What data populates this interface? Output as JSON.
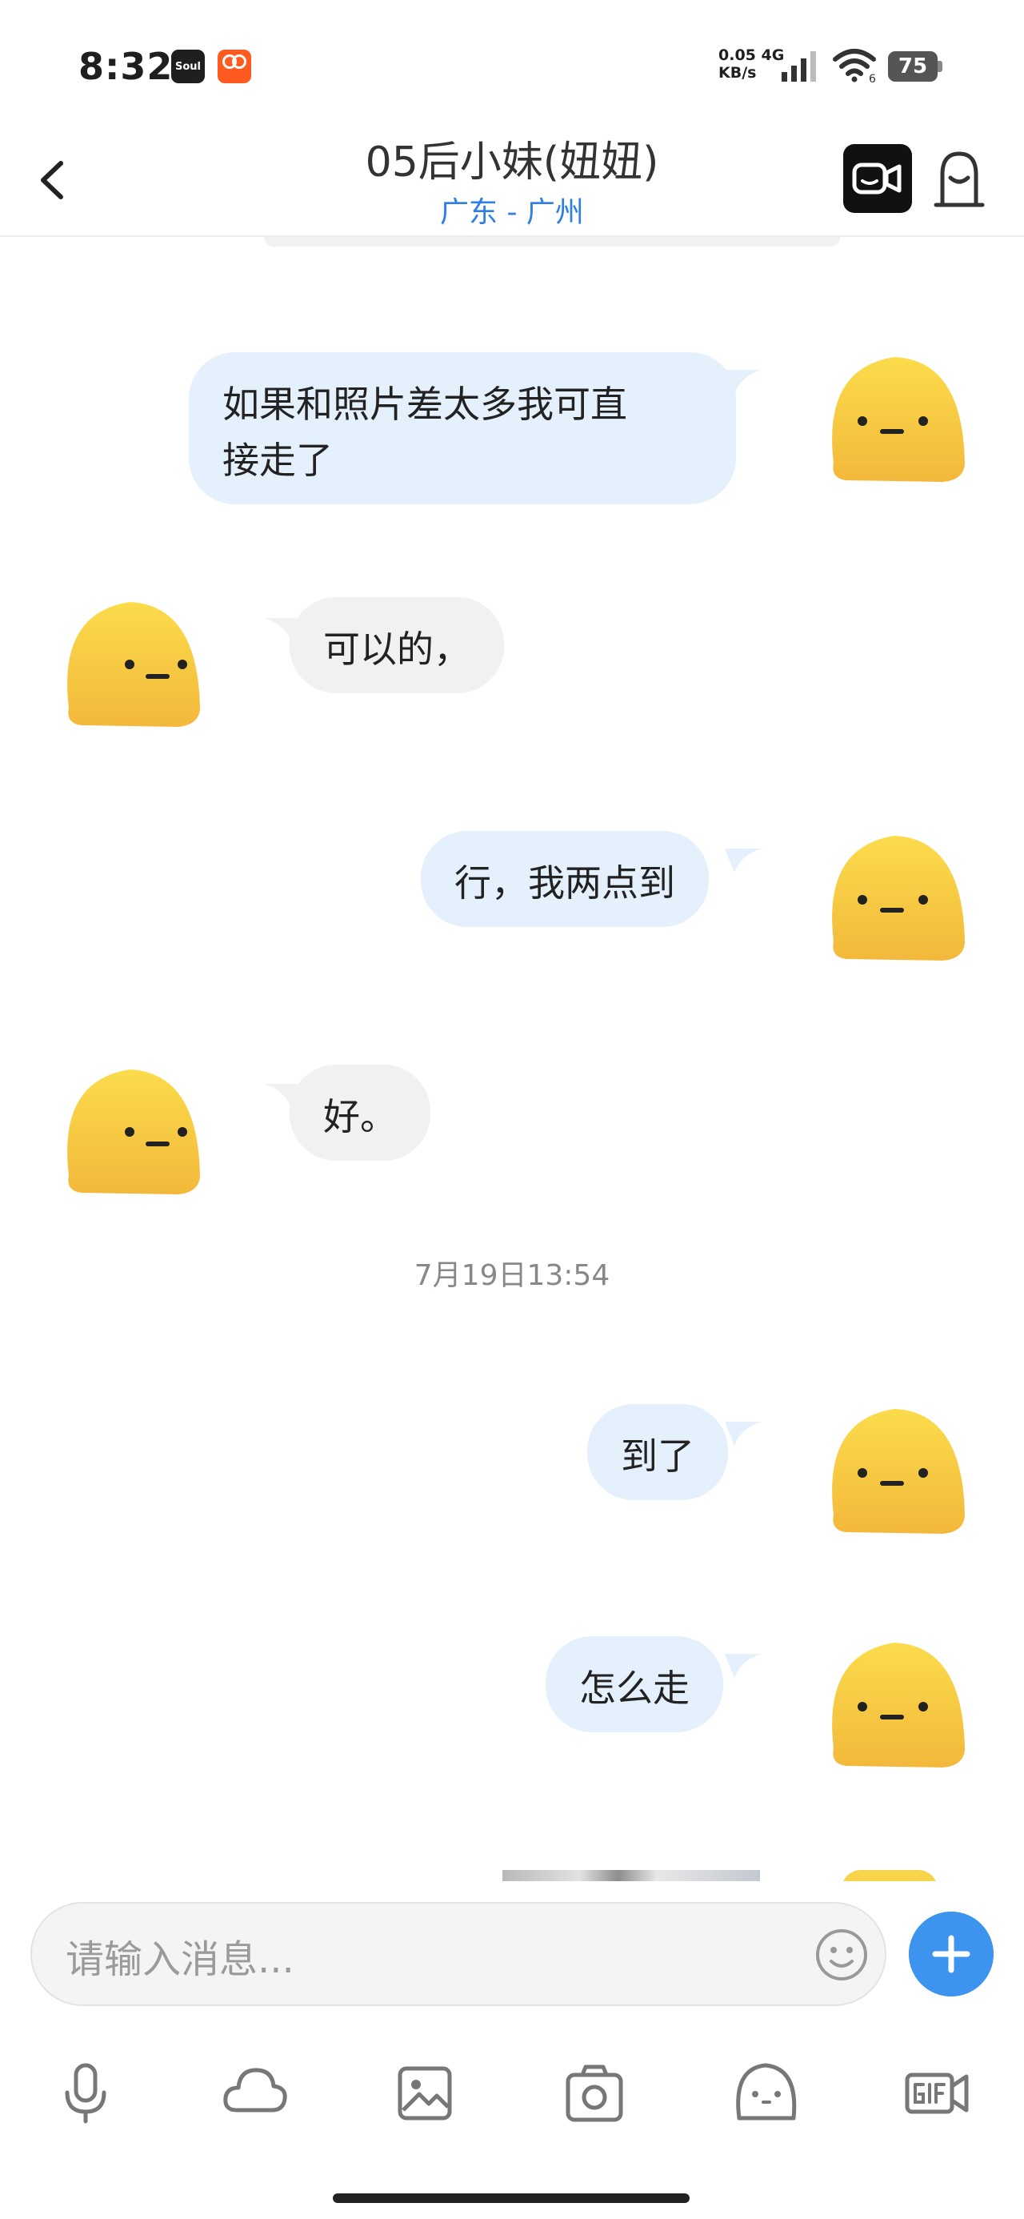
{
  "status_bar": {
    "time": "8:32",
    "soul_app_label": "Soul",
    "net_speed_value": "0.05",
    "net_type": "4G",
    "net_speed_unit": "KB/s",
    "wifi_label": "6",
    "battery": "75"
  },
  "header": {
    "title": "05后小妹(妞妞)",
    "subtitle": "广东 - 广州",
    "back_icon": "chevron-left-icon",
    "video_icon": "video-call-icon",
    "profile_icon": "user-profile-icon"
  },
  "messages": [
    {
      "sender": "me",
      "line1": "如果和照片差太多我可直",
      "line2": "接走了"
    },
    {
      "sender": "them",
      "text": "可以的，"
    },
    {
      "sender": "me",
      "text": "行，我两点到"
    },
    {
      "sender": "them",
      "text": "好。"
    },
    {
      "type": "timestamp",
      "text": "7月19日13:54"
    },
    {
      "sender": "me",
      "text": "到了"
    },
    {
      "sender": "me",
      "text": "怎么走"
    }
  ],
  "input": {
    "placeholder": "请输入消息...",
    "emoji_icon": "emoji-icon",
    "plus_icon": "plus-icon"
  },
  "toolbar": {
    "items": [
      "microphone-icon",
      "cloud-icon",
      "image-icon",
      "camera-icon",
      "sticker-face-icon",
      "gif-icon"
    ]
  },
  "colors": {
    "my_bubble": "#e4f0fc",
    "their_bubble": "#f1f1f1",
    "accent_blue": "#3d94ee",
    "subtitle_blue": "#2d7ee6",
    "avatar_yellow": "#f8d44a"
  }
}
